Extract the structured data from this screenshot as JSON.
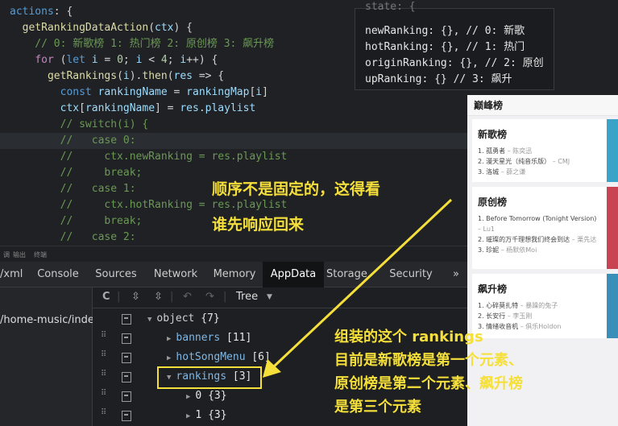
{
  "code": {
    "lines": [
      [
        [
          "kw2",
          "actions"
        ],
        [
          "op",
          ": {"
        ]
      ],
      [
        [
          "op",
          "  "
        ],
        [
          "fn",
          "getRankingDataAction"
        ],
        [
          "op",
          "("
        ],
        [
          "var",
          "ctx"
        ],
        [
          "op",
          ") {"
        ]
      ],
      [
        [
          "cm",
          "    // 0: 新歌榜 1: 热门榜 2: 原创榜 3: 飙升榜"
        ]
      ],
      [
        [
          "op",
          "    "
        ],
        [
          "kw",
          "for"
        ],
        [
          "op",
          " ("
        ],
        [
          "kw2",
          "let"
        ],
        [
          "op",
          " "
        ],
        [
          "var",
          "i"
        ],
        [
          "op",
          " = "
        ],
        [
          "num",
          "0"
        ],
        [
          "op",
          "; "
        ],
        [
          "var",
          "i"
        ],
        [
          "op",
          " < "
        ],
        [
          "num",
          "4"
        ],
        [
          "op",
          "; "
        ],
        [
          "var",
          "i"
        ],
        [
          "op",
          "++) {"
        ]
      ],
      [
        [
          "op",
          "      "
        ],
        [
          "fn",
          "getRankings"
        ],
        [
          "op",
          "("
        ],
        [
          "var",
          "i"
        ],
        [
          "op",
          ")."
        ],
        [
          "fn",
          "then"
        ],
        [
          "op",
          "("
        ],
        [
          "var",
          "res"
        ],
        [
          "op",
          " => {"
        ]
      ],
      [
        [
          "op",
          "        "
        ],
        [
          "kw2",
          "const"
        ],
        [
          "op",
          " "
        ],
        [
          "var",
          "rankingName"
        ],
        [
          "op",
          " = "
        ],
        [
          "var",
          "rankingMap"
        ],
        [
          "op",
          "["
        ],
        [
          "var",
          "i"
        ],
        [
          "op",
          "]"
        ]
      ],
      [
        [
          "op",
          "        "
        ],
        [
          "var",
          "ctx"
        ],
        [
          "op",
          "["
        ],
        [
          "var",
          "rankingName"
        ],
        [
          "op",
          "] = "
        ],
        [
          "var",
          "res"
        ],
        [
          "op",
          "."
        ],
        [
          "var",
          "playlist"
        ]
      ],
      [
        [
          "cm",
          "        // switch(i) {"
        ]
      ],
      [
        [
          "cm",
          "        //   case 0:"
        ]
      ],
      [
        [
          "cm",
          "        //     ctx.newRanking = res.playlist"
        ]
      ],
      [
        [
          "cm",
          "        //     break;"
        ]
      ],
      [
        [
          "cm",
          "        //   case 1:"
        ]
      ],
      [
        [
          "cm",
          "        //     ctx.hotRanking = res.playlist"
        ]
      ],
      [
        [
          "cm",
          "        //     break;"
        ]
      ],
      [
        [
          "cm",
          "        //   case 2:"
        ]
      ]
    ],
    "state_popup": [
      "state: {",
      "newRanking: {}, // 0: 新歌",
      "hotRanking: {}, // 1: 热门",
      "originRanking: {}, // 2: 原创",
      "upRanking: {} // 3: 飙升"
    ]
  },
  "preview": {
    "title": "巅峰榜",
    "cards": [
      {
        "name": "新歌榜",
        "items": [
          [
            "1. 孤勇者",
            " – 陈奕迅"
          ],
          [
            "2. 漫天星光（纯音乐版）",
            " – CMJ"
          ],
          [
            "3. 洛城",
            " – 薛之谦"
          ]
        ],
        "color": "#3aa3c7"
      },
      {
        "name": "原创榜",
        "items": [
          [
            "1. Before Tomorrow (Tonight Version)",
            " – Lu1"
          ],
          [
            "2. 璀璨的万千理想我们终会到达",
            " – 栗先达"
          ],
          [
            "3. 珍妮",
            " – 杨默依Moi"
          ]
        ],
        "color": "#c94453"
      },
      {
        "name": "飙升榜",
        "items": [
          [
            "1. 心碎莫扎特",
            " – 暴躁的兔子"
          ],
          [
            "2. 长安行",
            " – 李玉刚"
          ],
          [
            "3. 情绪收音机",
            " – 俱乐Holdon"
          ]
        ],
        "color": "#3a8fb8"
      }
    ]
  },
  "devtools": {
    "subbar": [
      "调",
      "输出",
      "终端"
    ],
    "tabs": [
      "/xml",
      "Console",
      "Sources",
      "Network",
      "Memory",
      "AppData",
      "Storage",
      "Security",
      "»"
    ],
    "active_tab": "AppData",
    "page_path": "/home-music/index",
    "toolbar": {
      "refresh": "C",
      "expand": "⇳",
      "collapse": "⇳",
      "undo": "↶",
      "redo": "↷",
      "view": "Tree",
      "view_caret": "▼"
    },
    "tree": [
      {
        "tri": "▼",
        "key": "object",
        "val": "{7}",
        "indent": 0,
        "cls": "key-obj"
      },
      {
        "tri": "▶",
        "key": "banners",
        "val": "[11]",
        "indent": 1,
        "cls": "key"
      },
      {
        "tri": "▶",
        "key": "hotSongMenu",
        "val": "[6]",
        "indent": 1,
        "cls": "key"
      },
      {
        "tri": "▼",
        "key": "rankings",
        "val": "[3]",
        "indent": 1,
        "cls": "key"
      },
      {
        "tri": "▶",
        "key": "0",
        "val": "{3}",
        "indent": 2,
        "cls": "val"
      },
      {
        "tri": "▶",
        "key": "1",
        "val": "{3}",
        "indent": 2,
        "cls": "val"
      }
    ]
  },
  "annotations": {
    "note1": "顺序不是固定的，这得看",
    "note2": "谁先响应回来",
    "note3": [
      "组装的这个 rankings",
      "目前是新歌榜是第一个元素、",
      "原创榜是第二个元素、飙升榜",
      "是第三个元素"
    ],
    "accent": "#f5df3a"
  }
}
